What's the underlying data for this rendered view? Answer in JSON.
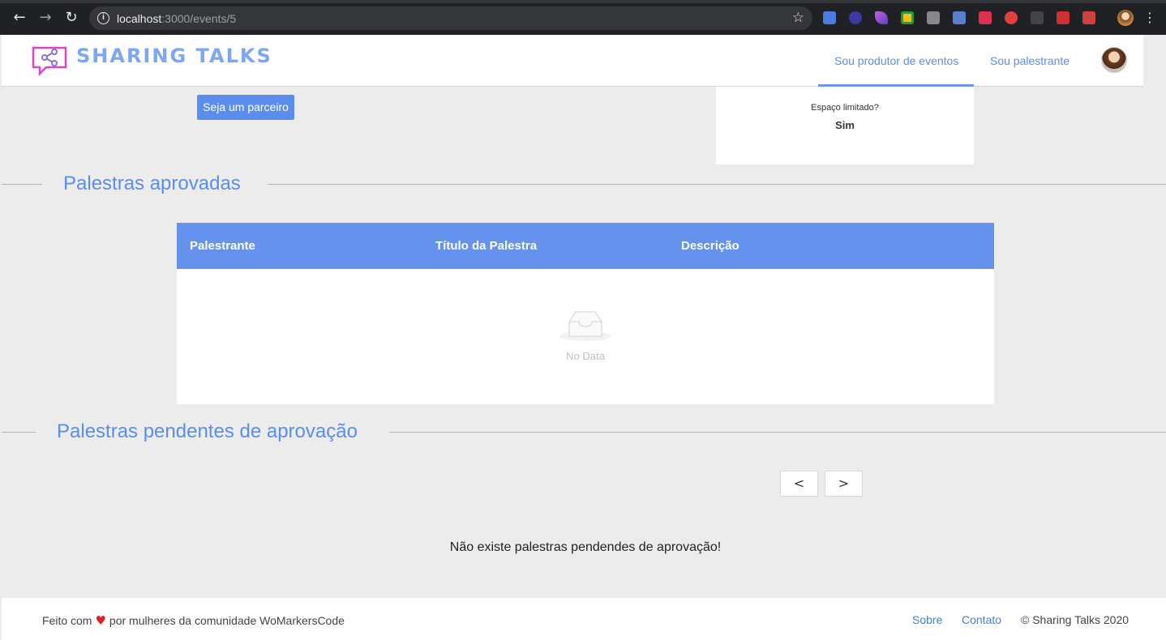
{
  "browser": {
    "url_host": "localhost",
    "url_path": ":3000/events/5"
  },
  "header": {
    "logo_text": "SHARING TALKS",
    "nav": {
      "producer": "Sou produtor de eventos",
      "speaker": "Sou palestrante"
    }
  },
  "event": {
    "partner_button": "Seja um parceiro",
    "limited_space_label": "Espaço limitado?",
    "limited_space_value": "Sim"
  },
  "approved": {
    "title": "Palestras aprovadas",
    "columns": [
      "Palestrante",
      "Título da Palestra",
      "Descrição"
    ],
    "empty_text": "No Data"
  },
  "pending": {
    "title": "Palestras pendentes de aprovação",
    "prev": "<",
    "next": ">",
    "empty_message": "Não existe palestras pendendes de aprovação!"
  },
  "footer": {
    "made_prefix": "Feito com",
    "made_suffix": "por mulheres da comunidade WoMarkersCode",
    "about": "Sobre",
    "contact": "Contato",
    "copyright": "© Sharing Talks 2020"
  }
}
